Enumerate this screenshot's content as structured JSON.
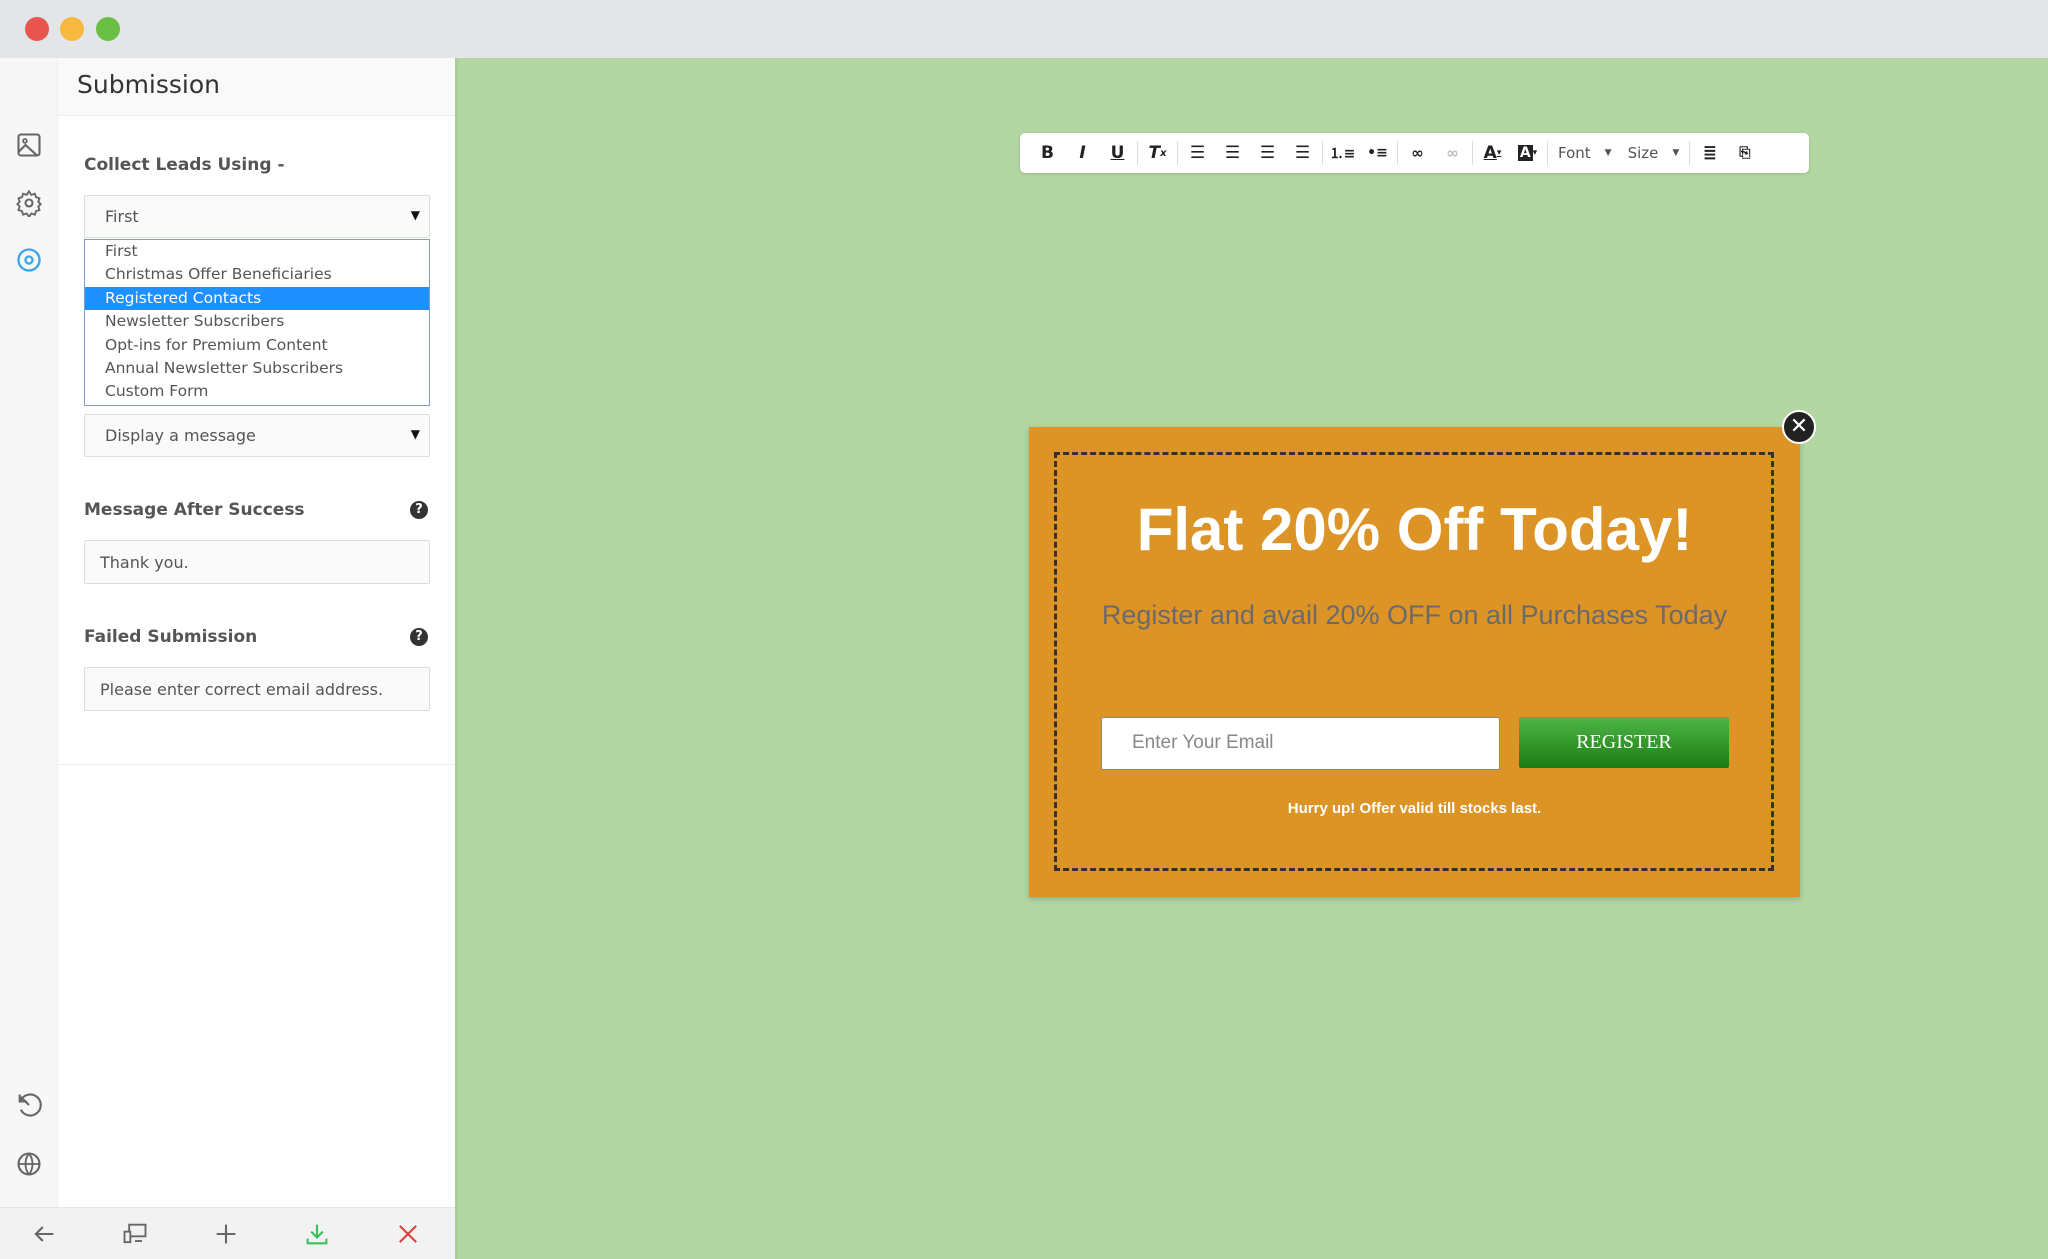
{
  "window": {
    "controls": {
      "close_color": "#e8554e",
      "minimize_color": "#f7b83f",
      "maximize_color": "#6ac045"
    }
  },
  "rail": {
    "icons": [
      "image-icon",
      "gear-icon",
      "target-icon",
      "history-icon",
      "globe-icon"
    ],
    "active_color": "#3aa6e8"
  },
  "panel": {
    "title": "Submission",
    "collect_label": "Collect Leads Using -",
    "collect_select": {
      "value": "First",
      "options": [
        "First",
        "Christmas Offer Beneficiaries",
        "Registered Contacts",
        "Newsletter Subscribers",
        "Opt-ins for Premium Content",
        "Annual Newsletter Subscribers",
        "Custom Form"
      ],
      "highlighted": "Registered Contacts"
    },
    "action_select": {
      "value": "Display a message"
    },
    "success_label": "Message After Success",
    "success_value": "Thank you.",
    "failed_label": "Failed Submission",
    "failed_value": "Please enter correct email address.",
    "help_glyph": "?"
  },
  "bottombar": {
    "icons": [
      "back-arrow-icon",
      "responsive-devices-icon",
      "plus-icon",
      "download-icon",
      "close-icon"
    ]
  },
  "toolbar": {
    "font_label": "Font",
    "size_label": "Size",
    "bold": "B",
    "italic": "I",
    "underline": "U"
  },
  "popup": {
    "background": "#dd9426",
    "heading": "Flat 20% Off Today!",
    "subheading": "Register and avail 20% OFF on all Purchases Today",
    "email_placeholder": "Enter Your Email",
    "register_label": "REGISTER",
    "note": "Hurry up! Offer valid till stocks last."
  },
  "canvas": {
    "background": "#b3d7a3"
  }
}
